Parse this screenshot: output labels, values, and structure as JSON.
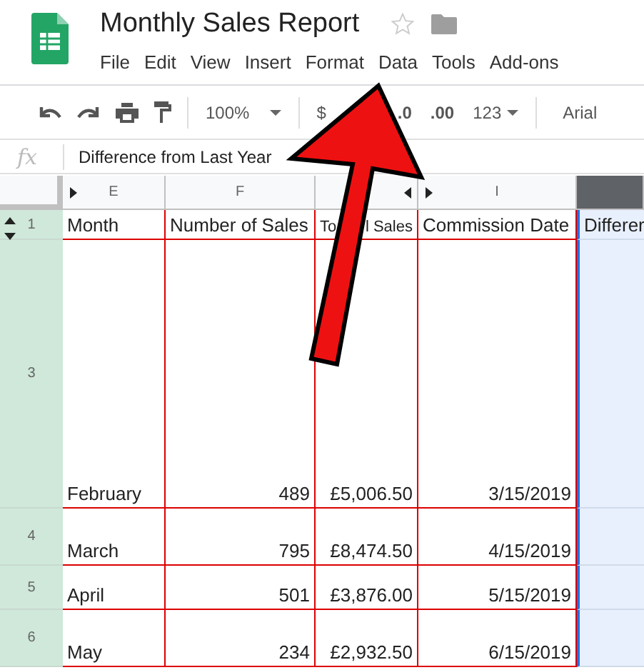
{
  "document": {
    "title": "Monthly Sales Report",
    "starred": false
  },
  "menu": [
    "File",
    "Edit",
    "View",
    "Insert",
    "Format",
    "Data",
    "Tools",
    "Add-ons"
  ],
  "toolbar": {
    "zoom": "100%",
    "currency": "$",
    "decrease_decimals": ".0",
    "increase_decimals": ".00",
    "number_format": "123",
    "font": "Arial"
  },
  "formula_bar": {
    "label": "fx",
    "value": "Difference from Last Year"
  },
  "columns": [
    {
      "label": "E",
      "selected": false
    },
    {
      "label": "F",
      "selected": false
    },
    {
      "selected": false
    },
    {
      "label": "I",
      "selected": false
    },
    {
      "selected": true
    }
  ],
  "rows": [
    {
      "number": "1",
      "cells": [
        "Month",
        "Number of Sales",
        {
          "parts": [
            "To",
            "l Sales"
          ]
        },
        "Commission Date",
        "Differer"
      ]
    },
    {
      "number": "3",
      "cells": [
        "February",
        "489",
        "£5,006.50",
        "3/15/2019",
        ""
      ]
    },
    {
      "number": "4",
      "cells": [
        "March",
        "795",
        "£8,474.50",
        "4/15/2019",
        ""
      ]
    },
    {
      "number": "5",
      "cells": [
        "April",
        "501",
        "£3,876.00",
        "5/15/2019",
        ""
      ]
    },
    {
      "number": "6",
      "cells": [
        "May",
        "234",
        "£2,932.50",
        "6/15/2019",
        ""
      ]
    }
  ]
}
